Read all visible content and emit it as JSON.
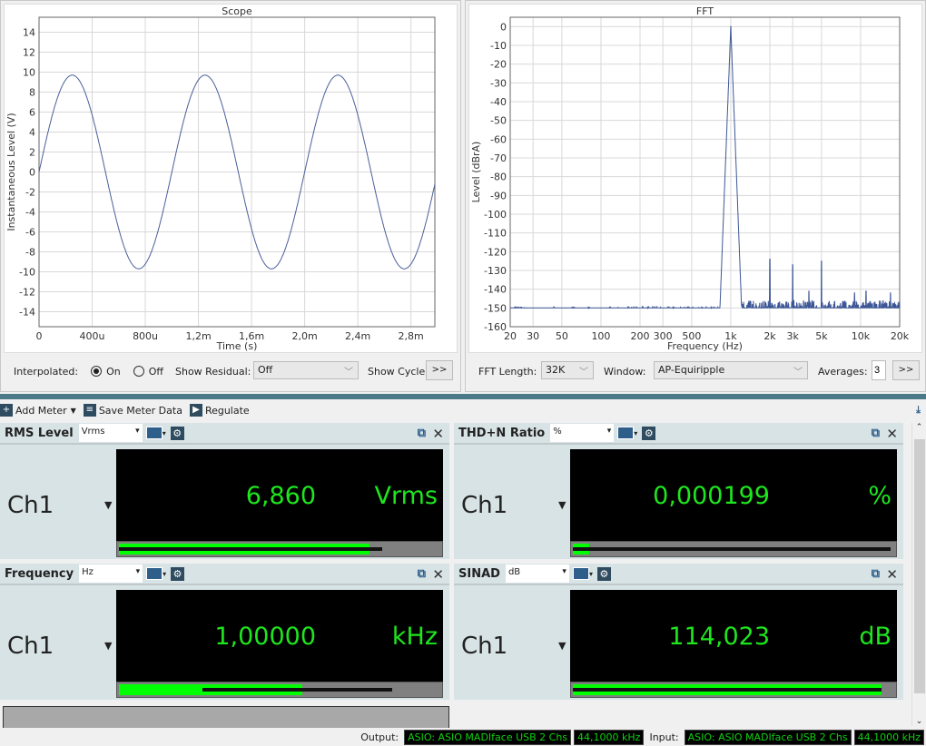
{
  "scope": {
    "title": "Scope",
    "interpolated_label": "Interpolated:",
    "on_label": "On",
    "off_label": "Off",
    "show_residual_label": "Show Residual:",
    "show_residual_value": "Off",
    "show_cycle_label": "Show Cycle",
    "more_label": ">>"
  },
  "fft": {
    "title": "FFT",
    "fft_length_label": "FFT Length:",
    "fft_length_value": "32K",
    "window_label": "Window:",
    "window_value": "AP-Equiripple",
    "averages_label": "Averages:",
    "averages_value": "3",
    "more_label": ">>"
  },
  "toolbar": {
    "add_meter": "Add Meter",
    "save_meter_data": "Save Meter Data",
    "regulate": "Regulate"
  },
  "meters": [
    {
      "title": "RMS Level",
      "unit_select": "Vrms",
      "channel": "Ch1",
      "value": "6,860",
      "unit": "Vrms",
      "bar_fraction": 0.78,
      "line_start": 0,
      "line_end": 0.82
    },
    {
      "title": "THD+N Ratio",
      "unit_select": "%",
      "channel": "Ch1",
      "value": "0,000199",
      "unit": "%",
      "bar_fraction": 0.05,
      "line_start": 0,
      "line_end": 0.99
    },
    {
      "title": "Frequency",
      "unit_select": "Hz",
      "channel": "Ch1",
      "value": "1,00000",
      "unit": "kHz",
      "bar_fraction": 0.57,
      "line_start": 0.26,
      "line_end": 0.85
    },
    {
      "title": "SINAD",
      "unit_select": "dB",
      "channel": "Ch1",
      "value": "114,023",
      "unit": "dB",
      "bar_fraction": 0.96,
      "line_start": 0,
      "line_end": 0.96
    }
  ],
  "status": {
    "output_label": "Output:",
    "output_device": "ASIO: ASIO MADIface USB 2 Chs",
    "output_rate": "44,1000 kHz",
    "input_label": "Input:",
    "input_device": "ASIO: ASIO MADIface USB 2 Chs",
    "input_rate": "44,1000 kHz"
  },
  "chart_data": [
    {
      "type": "line",
      "title": "Scope",
      "xlabel": "Time (s)",
      "ylabel": "Instantaneous Level (V)",
      "xlim": [
        0,
        0.00298
      ],
      "ylim": [
        -15.5,
        15.5
      ],
      "x_ticks": [
        {
          "v": 0,
          "label": "0"
        },
        {
          "v": 0.0004,
          "label": "400u"
        },
        {
          "v": 0.0008,
          "label": "800u"
        },
        {
          "v": 0.0012,
          "label": "1,2m"
        },
        {
          "v": 0.0016,
          "label": "1,6m"
        },
        {
          "v": 0.002,
          "label": "2,0m"
        },
        {
          "v": 0.0024,
          "label": "2,4m"
        },
        {
          "v": 0.0028,
          "label": "2,8m"
        }
      ],
      "y_ticks": [
        14,
        12,
        10,
        8,
        6,
        4,
        2,
        0,
        -2,
        -4,
        -6,
        -8,
        -10,
        -12,
        -14
      ],
      "series": [
        {
          "name": "Ch1",
          "frequency_hz": 1000,
          "amplitude_v": 9.7,
          "color": "#4a5f9a"
        }
      ],
      "grid": true
    },
    {
      "type": "line",
      "title": "FFT",
      "xlabel": "Frequency (Hz)",
      "ylabel": "Level (dBrA)",
      "xscale": "log",
      "xlim": [
        20,
        20000
      ],
      "ylim": [
        -160,
        5
      ],
      "x_ticks": [
        {
          "v": 20,
          "label": "20"
        },
        {
          "v": 30,
          "label": "30"
        },
        {
          "v": 50,
          "label": "50"
        },
        {
          "v": 100,
          "label": "100"
        },
        {
          "v": 200,
          "label": "200"
        },
        {
          "v": 300,
          "label": "300"
        },
        {
          "v": 500,
          "label": "500"
        },
        {
          "v": 1000,
          "label": "1k"
        },
        {
          "v": 2000,
          "label": "2k"
        },
        {
          "v": 3000,
          "label": "3k"
        },
        {
          "v": 5000,
          "label": "5k"
        },
        {
          "v": 10000,
          "label": "10k"
        },
        {
          "v": 20000,
          "label": "20k"
        }
      ],
      "y_ticks": [
        0,
        -10,
        -20,
        -30,
        -40,
        -50,
        -60,
        -70,
        -80,
        -90,
        -100,
        -110,
        -120,
        -130,
        -140,
        -150,
        -160
      ],
      "series": [
        {
          "name": "Ch1",
          "color": "#3d5796",
          "noise_floor_db": -153,
          "peaks": [
            {
              "f": 1000,
              "db": 0
            },
            {
              "f": 2000,
              "db": -124
            },
            {
              "f": 3000,
              "db": -127
            },
            {
              "f": 4000,
              "db": -141
            },
            {
              "f": 5000,
              "db": -125
            },
            {
              "f": 9000,
              "db": -142
            },
            {
              "f": 11000,
              "db": -141
            },
            {
              "f": 17000,
              "db": -142
            }
          ]
        }
      ],
      "grid": true
    }
  ]
}
